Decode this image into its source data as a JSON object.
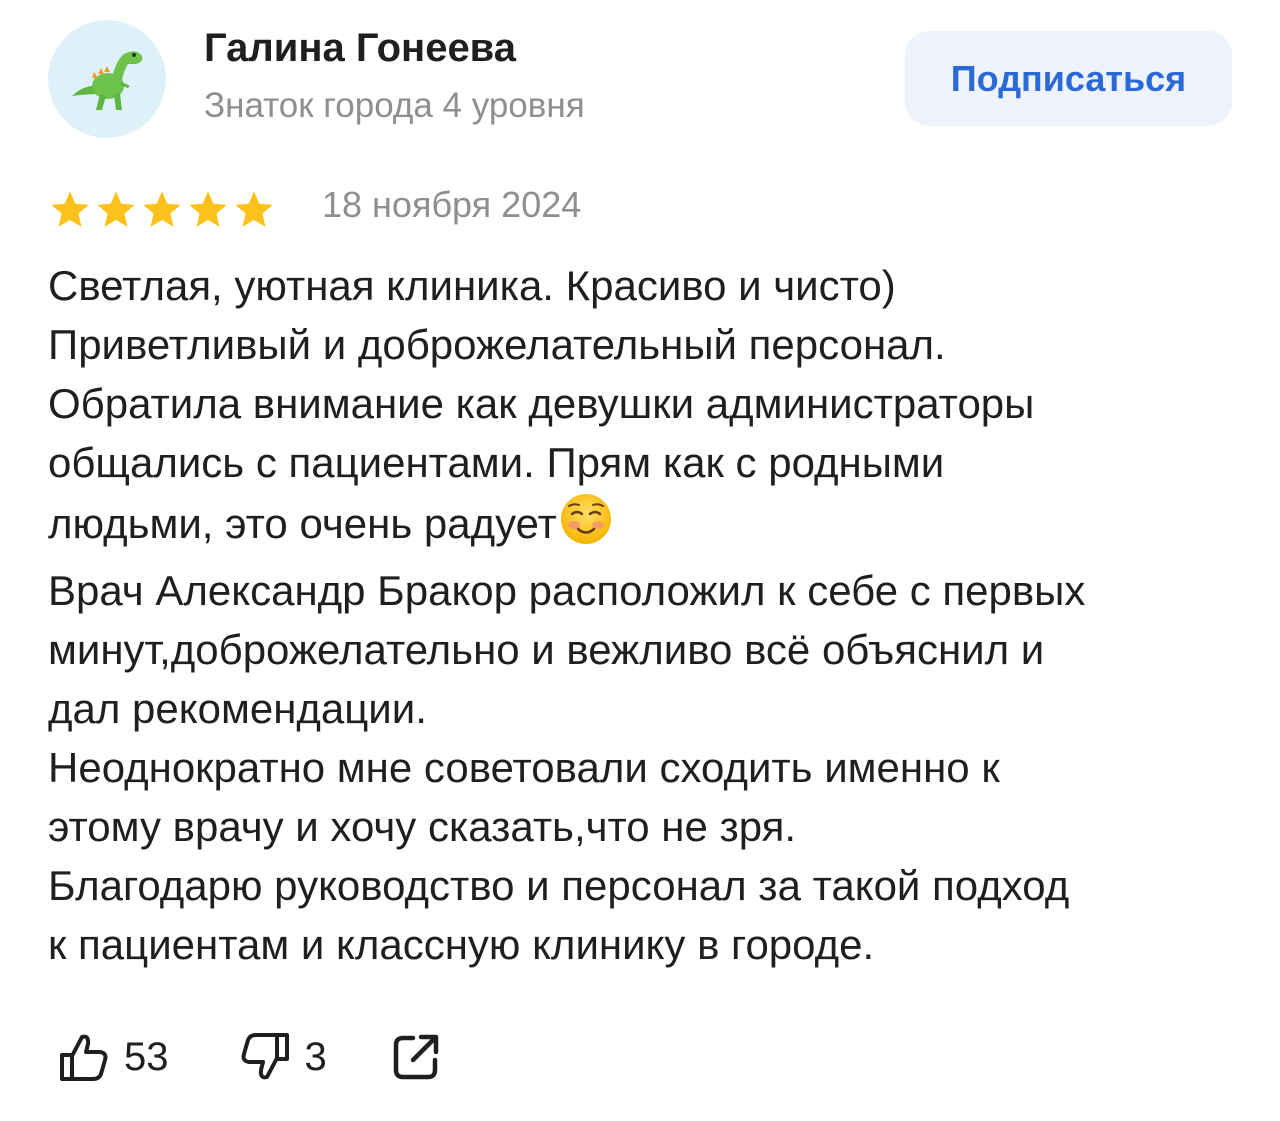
{
  "author": {
    "name": "Галина Гонеева",
    "level": "Знаток города 4 уровня",
    "avatar_icon": "dinosaur-icon"
  },
  "subscribe_label": "Подписаться",
  "review": {
    "rating": 5,
    "rating_max": 5,
    "date": "18 ноября 2024",
    "lines": [
      "Светлая, уютная клиника. Красиво и чисто)",
      "Приветливый и доброжелательный персонал.",
      "Обратила внимание как девушки администраторы",
      "общались с пациентами. Прям как с родными",
      "людьми, это очень радует",
      "Врач Александр Бракор расположил к себе с первых",
      "минут,доброжелательно и вежливо всё объяснил и",
      "дал рекомендации.",
      "Неоднократно мне советовали сходить именно к",
      "этому врачу и хочу сказать,что не зря.",
      "Благодарю руководство и персонал за такой подход",
      "к пациентам и классную клинику в городе."
    ],
    "emoji": "smiling-face-icon"
  },
  "actions": {
    "likes": "53",
    "dislikes": "3",
    "share_icon": "share-icon"
  },
  "colors": {
    "star": "#FCC21B",
    "accent": "#2B6AD6",
    "muted": "#8E8E93",
    "button_bg": "#EEF3FB"
  }
}
